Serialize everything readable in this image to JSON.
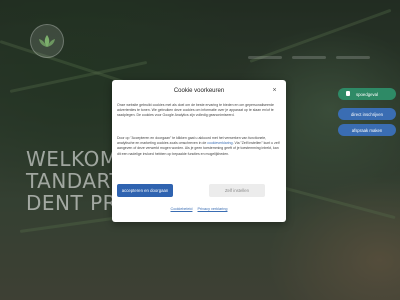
{
  "hero": {
    "line1": "WELKOM",
    "line2": "TANDART",
    "line3": "DENT PRO"
  },
  "side_buttons": {
    "emergency": "spoedgeval",
    "register": "direct inschrijven",
    "appointment": "afspraak maken"
  },
  "cookie_modal": {
    "title": "Cookie voorkeuren",
    "close_icon": "close-icon",
    "paragraph1": "Onze website gebruikt cookies met als doel om de beste ervaring te bieden en om gepersonaliseerde advertenties te tonen. We gebruiken deze cookies om informatie over je apparaat op te slaan en/of te raadplegen. De cookies voor Google Analytics zijn volledig geanonimiseerd.",
    "paragraph2_start": "Door op \"Accepteren en doorgaan\" te klikken gaat u akkoord met het verwerken van functionele, analytische en marketing cookies zoals omschreven in de ",
    "paragraph2_link": "cookieverklaring",
    "paragraph2_end": ". Via \"Zelf instellen\" kunt u zelf aangeven of deze verwerkt mogen worden. Als je geen toestemming geeft of je toestemming intrekt, kan dit een nadelige invloed hebben op bepaalde functies en mogelijkheden.",
    "accept_label": "accepteren en doorgaan",
    "customize_label": "Zelf instellen",
    "cookie_policy_link": "Cookiebeleid",
    "privacy_link": "Privacy verklaring"
  },
  "colors": {
    "accept_button": "#2f63b0",
    "emergency_button": "#2e8a66",
    "side_button": "#3a6db3",
    "link": "#3a6db3"
  }
}
